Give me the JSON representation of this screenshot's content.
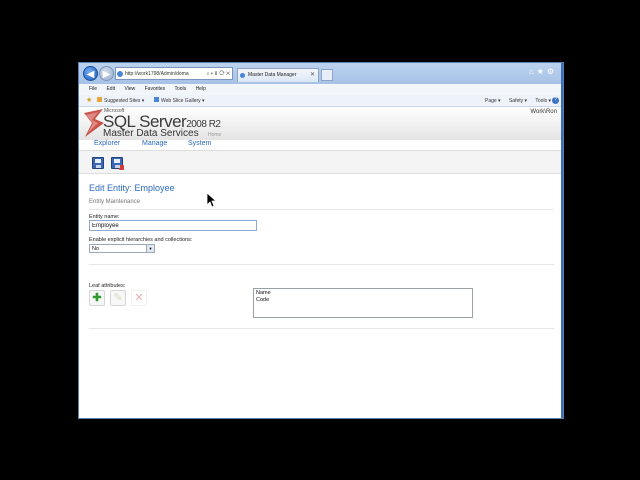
{
  "browser": {
    "address": "http://work1798/Admin/doma",
    "tab_title": "Master Data Manager",
    "menu": [
      "File",
      "Edit",
      "View",
      "Favorites",
      "Tools",
      "Help"
    ],
    "favorites": [
      "Suggested Sites ▾",
      "Web Slice Gallery ▾"
    ],
    "commands": [
      "Page ▾",
      "Safety ▾",
      "Tools ▾"
    ]
  },
  "banner": {
    "ms": "Microsoft",
    "product": "SQL Server",
    "version": "2008 R2",
    "subtitle": "Master Data Services",
    "home": "Home",
    "user": "Work\\Ron"
  },
  "nav": {
    "items": [
      "Explorer",
      "Manage",
      "System"
    ]
  },
  "page": {
    "title": "Edit Entity: Employee",
    "subtitle": "Entity Maintenance",
    "entity_name_label": "Entity name:",
    "entity_name_value": "Employee",
    "hierarchies_label": "Enable explicit hierarchies and collections:",
    "hierarchies_value": "No",
    "leaf_label": "Leaf attributes:",
    "attributes": [
      "Name",
      "Code"
    ]
  },
  "colors": {
    "accent": "#2b6bbf",
    "add_green": "#2e9c2e"
  }
}
